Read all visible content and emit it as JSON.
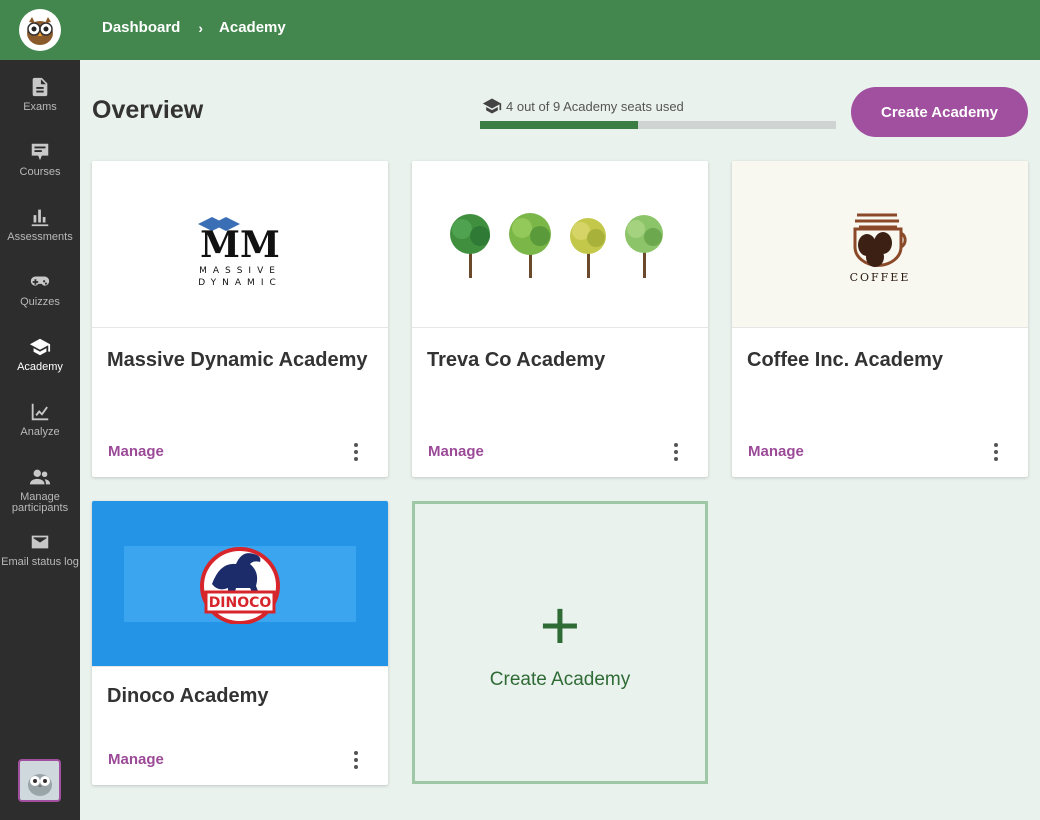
{
  "breadcrumb": {
    "items": [
      "Dashboard",
      "Academy"
    ],
    "separator": "›"
  },
  "nav": {
    "items": [
      {
        "label": "Exams",
        "icon": "document-icon"
      },
      {
        "label": "Courses",
        "icon": "certificate-icon"
      },
      {
        "label": "Assessments",
        "icon": "bar-chart-icon"
      },
      {
        "label": "Quizzes",
        "icon": "gamepad-icon"
      },
      {
        "label": "Academy",
        "icon": "graduation-cap-icon",
        "active": true
      },
      {
        "label": "Analyze",
        "icon": "line-chart-icon"
      },
      {
        "label": "Manage participants",
        "icon": "people-icon"
      },
      {
        "label": "Email status log",
        "icon": "envelope-icon"
      }
    ]
  },
  "header": {
    "title": "Overview",
    "seats_text": "4 out of 9 Academy seats used",
    "seats_used": 4,
    "seats_total": 9,
    "create_button": "Create Academy"
  },
  "cards": [
    {
      "title": "Massive Dynamic Academy",
      "logo_text": [
        "MASSIVE",
        "DYNAMIC"
      ],
      "manage": "Manage"
    },
    {
      "title": "Treva Co Academy",
      "manage": "Manage"
    },
    {
      "title": "Coffee Inc. Academy",
      "logo_text": "COFFEE",
      "manage": "Manage"
    },
    {
      "title": "Dinoco Academy",
      "logo_text": "DINOCO",
      "manage": "Manage"
    }
  ],
  "create_card": {
    "plus": "+",
    "label": "Create Academy"
  },
  "colors": {
    "brand_green": "#43874e",
    "accent_purple": "#a14f9f",
    "sidebar": "#2d2d2d",
    "progress_fill": "#3b7d43"
  }
}
